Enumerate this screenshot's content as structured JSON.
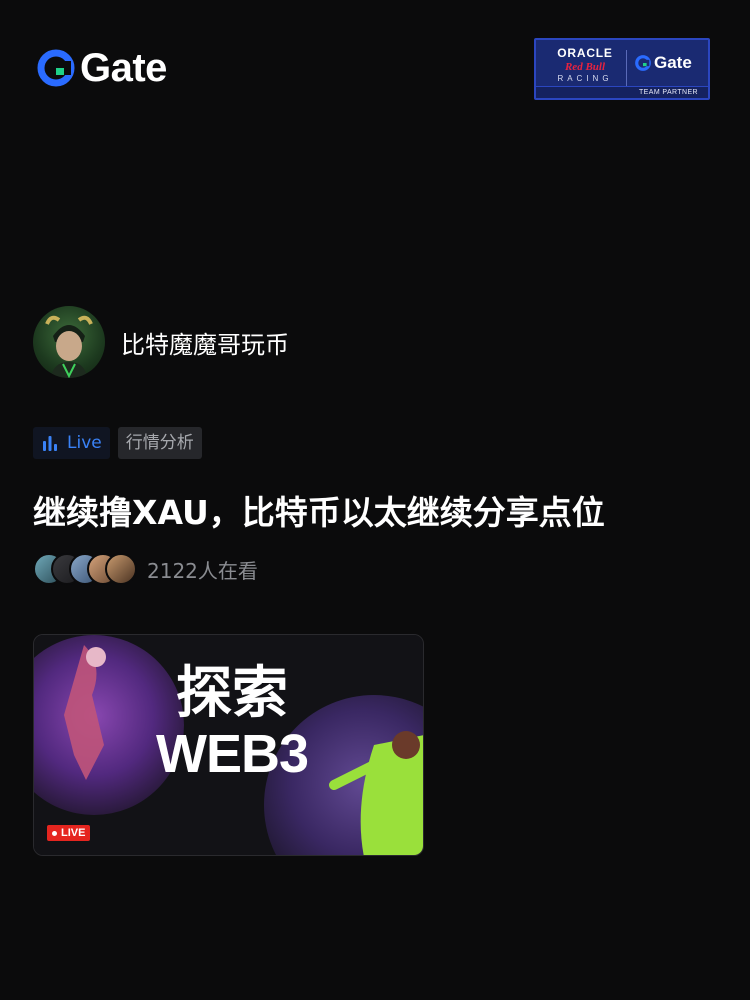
{
  "brand": {
    "name": "Gate",
    "icon": "gate-logo-icon",
    "accent": "#2a6bff"
  },
  "partner": {
    "line1": "ORACLE",
    "line2": "Red Bull",
    "line3": "RACING",
    "gate": "Gate",
    "footer": "TEAM PARTNER"
  },
  "host": {
    "name": "比特魔魔哥玩币",
    "avatar_icon": "avatar"
  },
  "tags": {
    "live_label": "Live",
    "live_icon": "bar-chart-icon",
    "category": "行情分析"
  },
  "stream": {
    "title": "继续撸XAU，比特币以太继续分享点位"
  },
  "viewers": {
    "text": "2122人在看",
    "avatars": [
      "viewer-1",
      "viewer-2",
      "viewer-3",
      "viewer-4",
      "viewer-5"
    ]
  },
  "cover": {
    "line1": "探索",
    "line2": "WEB3",
    "badge": "LIVE"
  },
  "colors": {
    "background": "#0b0b0c",
    "live_blue": "#3a82f6",
    "live_red": "#e5251f"
  }
}
